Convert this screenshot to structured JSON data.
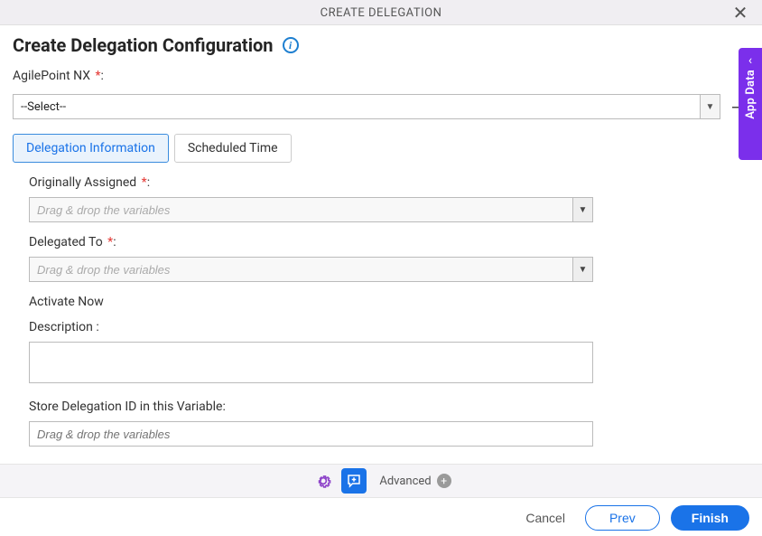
{
  "titlebar": {
    "title": "CREATE DELEGATION"
  },
  "heading": "Create Delegation Configuration",
  "agilepoint": {
    "label": "AgilePoint NX",
    "value": "--Select--"
  },
  "tabs": {
    "active": "Delegation Information",
    "other": "Scheduled Time"
  },
  "fields": {
    "originally": {
      "label": "Originally Assigned",
      "placeholder": "Drag & drop the variables",
      "value": ""
    },
    "delegated": {
      "label": "Delegated To",
      "placeholder": "Drag & drop the variables",
      "value": ""
    },
    "activate": "Activate Now",
    "description_label": "Description :",
    "description_value": "",
    "store_label": "Store Delegation ID in this Variable:",
    "store_placeholder": "Drag & drop the variables",
    "store_value": ""
  },
  "advbar": {
    "label": "Advanced"
  },
  "footer": {
    "cancel": "Cancel",
    "prev": "Prev",
    "finish": "Finish"
  },
  "sidetab": {
    "label": "App Data"
  },
  "colors": {
    "primary": "#1a73e8",
    "accent": "#7b2feb"
  }
}
